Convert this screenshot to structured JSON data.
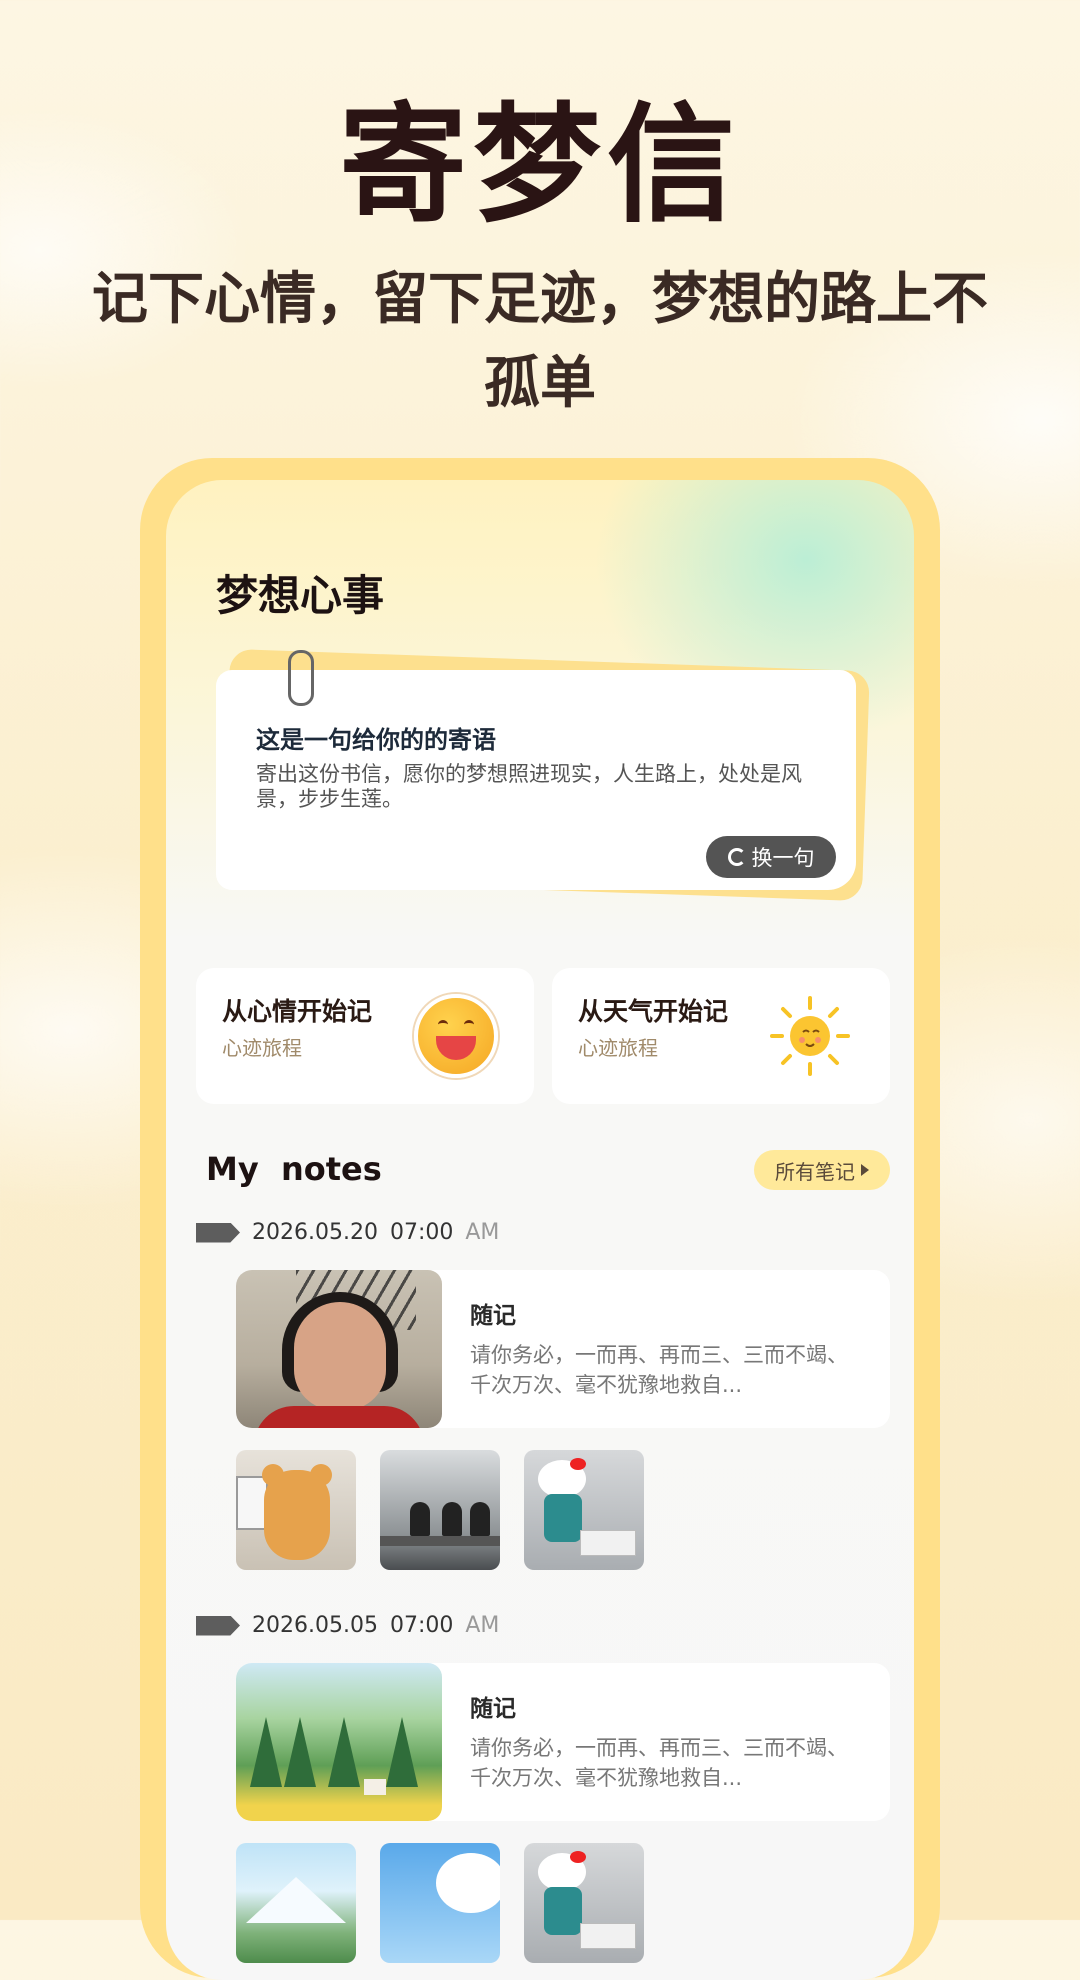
{
  "promo": {
    "app_name": "寄梦信",
    "tagline": "记下心情，留下足迹，梦想的路上不孤单"
  },
  "screen": {
    "section_title": "梦想心事",
    "quote": {
      "title": "这是一句给你的的寄语",
      "text": "寄出这份书信，愿你的梦想照进现实，人生路上，处处是风景，步步生莲。",
      "refresh_label": "换一句"
    },
    "entry_cards": [
      {
        "title": "从心情开始记",
        "subtitle": "心迹旅程",
        "icon": "smiley-face-icon"
      },
      {
        "title": "从天气开始记",
        "subtitle": "心迹旅程",
        "icon": "sun-icon"
      }
    ],
    "notes_header": "My  notes",
    "all_notes_label": "所有笔记",
    "notes": [
      {
        "date": "2026.05.20",
        "time": "07:00",
        "ampm": "AM",
        "title": "随记",
        "text": "请你务必，一而再、再而三、三而不竭、千次万次、毫不犹豫地救自...",
        "thumb": "portrait-photo",
        "photos": [
          "bear-at-computer-photo",
          "office-photo",
          "hello-kitty-photo"
        ]
      },
      {
        "date": "2026.05.05",
        "time": "07:00",
        "ampm": "AM",
        "title": "随记",
        "text": "请你务必，一而再、再而三、三而不竭、千次万次、毫不犹豫地救自...",
        "thumb": "forest-painting",
        "photos": [
          "mountain-painting",
          "sky-clouds-painting",
          "hello-kitty-photo"
        ]
      }
    ]
  },
  "colors": {
    "frame": "#ffe08a",
    "accent_yellow": "#fde08e",
    "button_dark": "#545454"
  }
}
